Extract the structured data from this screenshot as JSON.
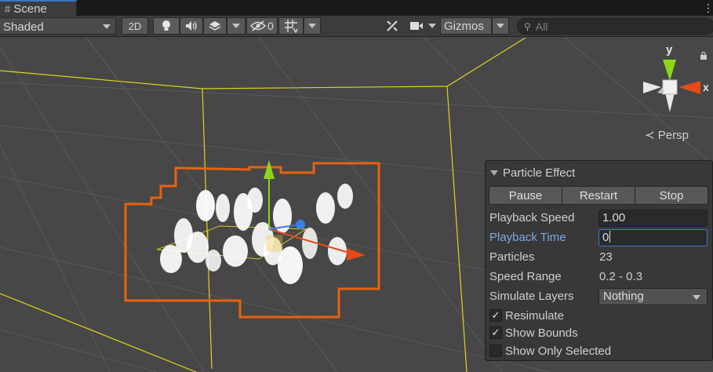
{
  "tab": {
    "label": "Scene",
    "icon": "hash-grid-icon"
  },
  "toolbar": {
    "shading_mode": "Shaded",
    "mode_2d": "2D",
    "hidden_count": "0",
    "gizmos_label": "Gizmos",
    "search_placeholder": "All"
  },
  "viewport": {
    "projection_label": "Persp",
    "axis_y": "y",
    "axis_x": "x"
  },
  "particle_panel": {
    "title": "Particle Effect",
    "buttons": {
      "pause": "Pause",
      "restart": "Restart",
      "stop": "Stop"
    },
    "playback_speed": {
      "label": "Playback Speed",
      "value": "1.00"
    },
    "playback_time": {
      "label": "Playback Time",
      "value": "0"
    },
    "particles": {
      "label": "Particles",
      "value": "23"
    },
    "speed_range": {
      "label": "Speed Range",
      "value": "0.2 - 0.3"
    },
    "simulate_layers": {
      "label": "Simulate Layers",
      "value": "Nothing"
    },
    "resimulate": {
      "label": "Resimulate",
      "checked": true
    },
    "show_bounds": {
      "label": "Show Bounds",
      "checked": true
    },
    "show_only_selected": {
      "label": "Show Only Selected",
      "checked": false
    }
  },
  "colors": {
    "bounds_orange": "#e8620f",
    "grid_yellow": "#e3d21e",
    "accent_blue": "#3a79bb",
    "axis_green": "#8dd61d",
    "axis_red": "#e64a19"
  }
}
